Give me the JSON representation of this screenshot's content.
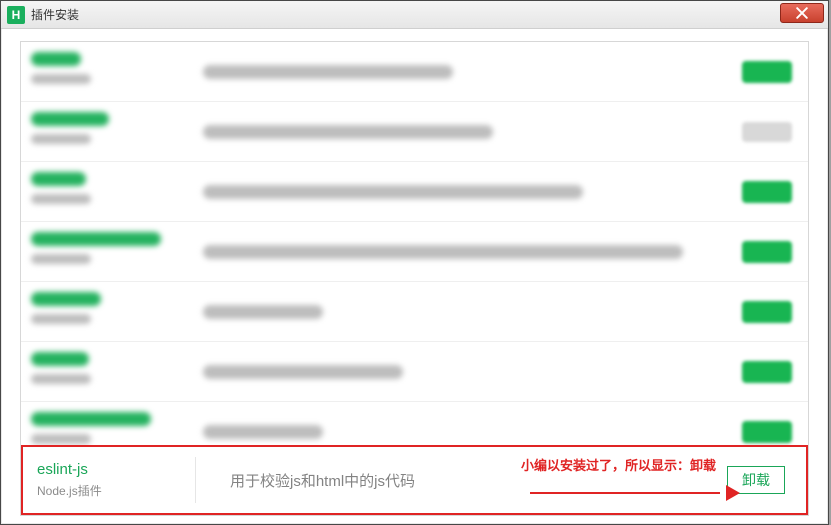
{
  "window": {
    "title": "插件安装",
    "icon_letter": "H"
  },
  "blurred_rows": [
    {
      "title_w": 50,
      "desc_w": 250,
      "action": "green"
    },
    {
      "title_w": 78,
      "desc_w": 290,
      "action": "gray"
    },
    {
      "title_w": 55,
      "desc_w": 380,
      "action": "green"
    },
    {
      "title_w": 130,
      "desc_w": 480,
      "action": "green"
    },
    {
      "title_w": 70,
      "desc_w": 120,
      "action": "green"
    },
    {
      "title_w": 58,
      "desc_w": 200,
      "action": "green"
    },
    {
      "title_w": 120,
      "desc_w": 120,
      "action": "green"
    }
  ],
  "focus": {
    "name": "eslint-js",
    "type": "Node.js插件",
    "description": "用于校验js和html中的js代码",
    "button_label": "卸载",
    "annotation": "小编以安装过了，所以显示：卸载"
  }
}
